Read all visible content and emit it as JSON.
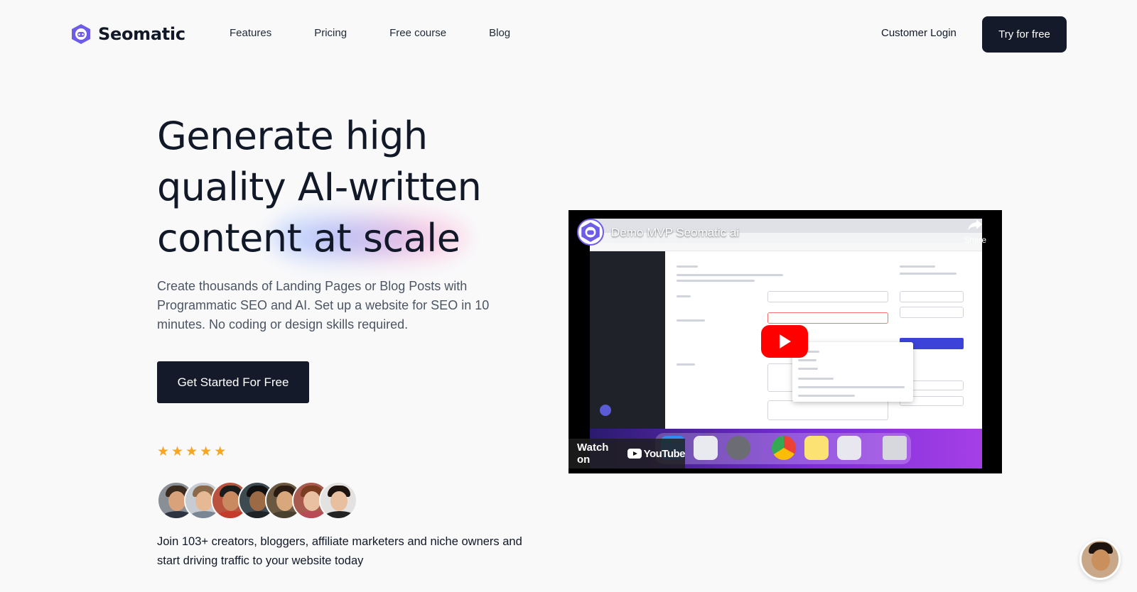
{
  "brand": {
    "name": "Seomatic",
    "accent": "#6d5ce7"
  },
  "nav": {
    "links": [
      "Features",
      "Pricing",
      "Free course",
      "Blog"
    ],
    "login": "Customer Login",
    "cta": "Try for free"
  },
  "hero": {
    "title": "Generate high quality AI-written content at scale",
    "subtitle": "Create thousands of Landing Pages or Blog Posts with Programmatic SEO and AI. Set up a website for SEO in 10 minutes. No coding or design skills required.",
    "cta": "Get Started For Free",
    "rating": 5,
    "star_color": "#f5a623",
    "avatar_count": 7,
    "social_proof": "Join 103+ creators, bloggers, affiliate marketers and niche owners and start driving traffic to your website today"
  },
  "video": {
    "title": "Demo MVP Seomatic ai",
    "share_label": "Share",
    "watch_label": "Watch on",
    "platform": "YouTube"
  },
  "icons": {
    "logo": "robot-icon",
    "play": "play-icon",
    "share": "share-arrow-icon",
    "chat": "chat-avatar-icon"
  }
}
